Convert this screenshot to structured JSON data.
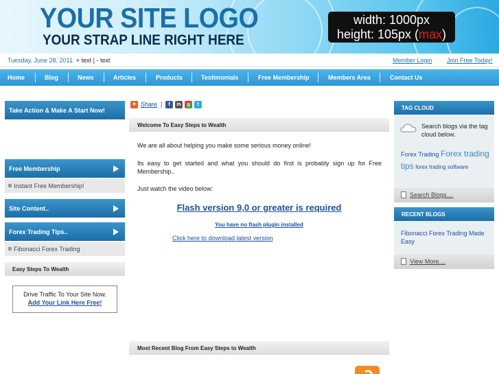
{
  "header": {
    "logo": "YOUR SITE LOGO",
    "strapline": "YOUR STRAP LINE RIGHT HERE",
    "dimension_note": {
      "width_line": "width: 1000px",
      "height_prefix": "height: 105px (",
      "height_max": "max",
      "height_suffix": ")"
    }
  },
  "subbar": {
    "date": "Tuesday, June 28, 2011",
    "extra": "+ text | - text",
    "member_login": "Member Login",
    "join_free": "Join Free Today!"
  },
  "nav": {
    "items": [
      "Home",
      "Blog",
      "News",
      "Articles",
      "Products",
      "Testimonials",
      "Free Membership",
      "Members Area",
      "Contact Us"
    ]
  },
  "left": {
    "take_action": "Take Action & Make A Start Now!",
    "free_membership": "Free Membership",
    "free_membership_item": "Instant Free Membership!",
    "site_content": "Site Content..",
    "forex_tips": "Forex Trading Tips..",
    "forex_item": "Fibonacci Forex Trading",
    "easy_steps": "Easy Steps To Wealth",
    "ad_line1": "Drive Traffic To Your Site Now.",
    "ad_line2": "Add Your Link Here Free!"
  },
  "center": {
    "share_label": "Share",
    "share_sep": "|",
    "welcome_title": "Welcome To Easy Steps to Wealth",
    "para1": "We are all about helping you make some serious money online!",
    "para2": "Its easy to get started and what you should do first is probably sign up for Free Membership..",
    "para3": "Just watch the video below:",
    "flash_title": "Flash version 9,0 or greater is required",
    "flash_sub": "You have no flash plugin installed",
    "flash_download": "Click here to download latest version",
    "recent_title": "Most Recent Blog From Easy Steps to Wealth"
  },
  "right": {
    "tag_cloud_title": "TAG CLOUD",
    "tag_cloud_text": "Search blogs via the tag cloud below.",
    "tags": [
      "Forex Trading",
      "Forex trading tips",
      "forex trading software"
    ],
    "search_blogs": "Search Blogs....",
    "recent_blogs_title": "RECENT BLOGS",
    "recent_blog_item": "Fibonacci Forex Trading Made Easy",
    "view_more": "View More...."
  },
  "colors": {
    "nav_blue": "#2e97d6",
    "box_blue": "#1c6ea6",
    "link_blue": "#1f4fa3",
    "max_red": "#e31d1d"
  }
}
